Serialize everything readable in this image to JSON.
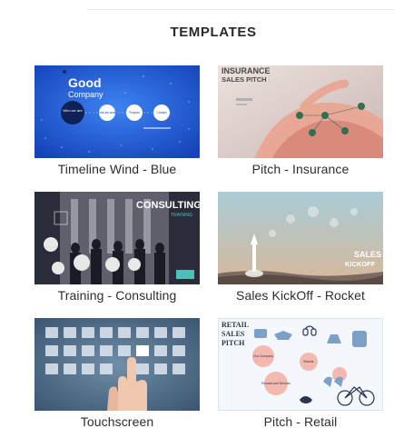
{
  "section_title": "TEMPLATES",
  "templates": [
    {
      "label": "Timeline Wind - Blue",
      "thumb_text": {
        "title": "Good",
        "subtitle": "Company",
        "node1": "Who we are",
        "node2": "How we work",
        "node3": "Projects",
        "node4": "Contact"
      }
    },
    {
      "label": "Pitch - Insurance",
      "thumb_text": {
        "title": "INSURANCE",
        "subtitle": "SALES PITCH"
      }
    },
    {
      "label": "Training - Consulting",
      "thumb_text": {
        "title": "CONSULTING",
        "subtitle": "TRAINING"
      }
    },
    {
      "label": "Sales KickOff - Rocket",
      "thumb_text": {
        "title": "SALES",
        "subtitle": "KICKOFF"
      }
    },
    {
      "label": "Touchscreen",
      "thumb_text": {}
    },
    {
      "label": "Pitch - Retail",
      "thumb_text": {
        "line1": "RETAIL",
        "line2": "SALES",
        "line3": "PITCH",
        "bubble1": "Our Company",
        "bubble2": "Products and Services",
        "bubble3": "Brands"
      }
    }
  ],
  "colors": {
    "timeline_bg": "#1f5fd8",
    "insurance_bg": "#e7d9d5",
    "consulting_bg": "#2a2c3a",
    "rocket_sky": "#9fc3cf",
    "touch_bg": "#4f6e8e",
    "retail_bg": "#f4f7fb"
  }
}
